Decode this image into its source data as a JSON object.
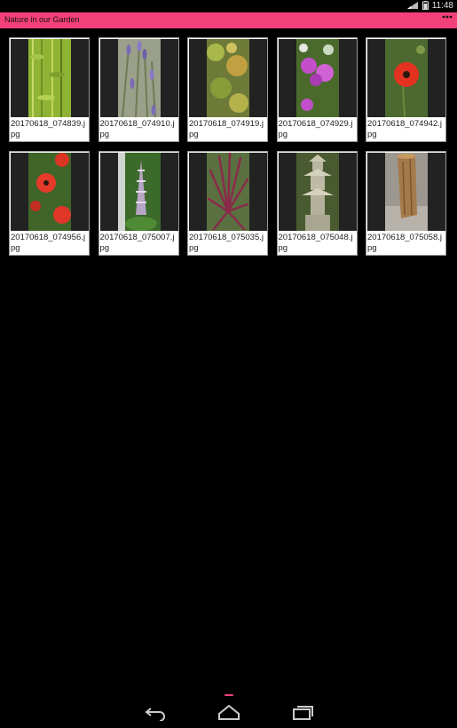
{
  "status": {
    "time": "11:48",
    "icons": [
      "wifi-icon",
      "signal-icon",
      "battery-icon"
    ]
  },
  "app": {
    "title": "Nature in our Garden",
    "menu_icon": "overflow-menu-icon",
    "accent": "#f4407a"
  },
  "gallery": {
    "items": [
      {
        "filename": "20170618_074839.jpg",
        "subject": "bamboo"
      },
      {
        "filename": "20170618_074910.jpg",
        "subject": "lavender"
      },
      {
        "filename": "20170618_074919.jpg",
        "subject": "maple"
      },
      {
        "filename": "20170618_074929.jpg",
        "subject": "pink-flowers"
      },
      {
        "filename": "20170618_074942.jpg",
        "subject": "poppy"
      },
      {
        "filename": "20170618_074956.jpg",
        "subject": "poppies"
      },
      {
        "filename": "20170618_075007.jpg",
        "subject": "acanthus"
      },
      {
        "filename": "20170618_075035.jpg",
        "subject": "cordyline"
      },
      {
        "filename": "20170618_075048.jpg",
        "subject": "stone-lantern"
      },
      {
        "filename": "20170618_075058.jpg",
        "subject": "tree-stump"
      }
    ]
  },
  "navigation": {
    "back": "back-icon",
    "home": "home-icon",
    "recents": "recents-icon"
  }
}
